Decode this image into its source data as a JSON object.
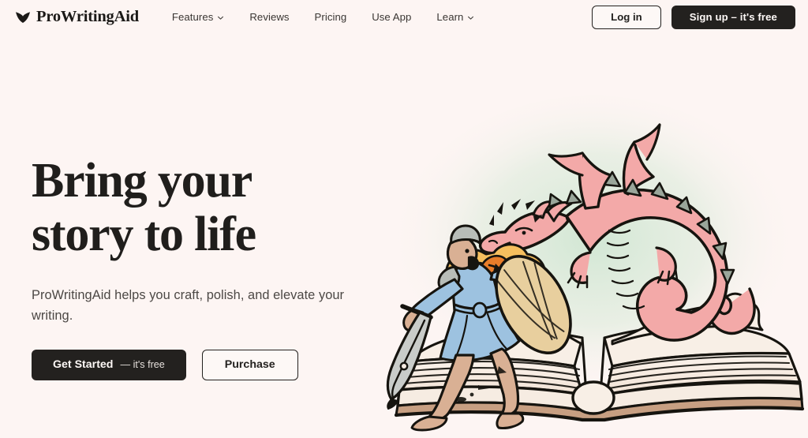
{
  "header": {
    "brand": {
      "name": "ProWritingAid",
      "mark_icon": "feather-chevron-logo-icon"
    },
    "nav": [
      {
        "label": "Features",
        "has_dropdown": true,
        "icon": "chevron-down-icon"
      },
      {
        "label": "Reviews",
        "has_dropdown": false,
        "icon": ""
      },
      {
        "label": "Pricing",
        "has_dropdown": false,
        "icon": ""
      },
      {
        "label": "Use App",
        "has_dropdown": false,
        "icon": ""
      },
      {
        "label": "Learn",
        "has_dropdown": true,
        "icon": "chevron-down-icon"
      }
    ],
    "login_label": "Log in",
    "signup_label": "Sign up – it's free"
  },
  "hero": {
    "title_line1": "Bring your",
    "title_line2": "story to life",
    "subtitle": "ProWritingAid helps you craft, polish, and elevate your writing.",
    "cta_primary_strong": "Get Started",
    "cta_primary_light": "— it's free",
    "cta_secondary": "Purchase",
    "illustration_name": "knight-fighting-dragon-on-open-book-illustration"
  },
  "colors": {
    "page_background": "#fdf5f3",
    "ink": "#23211f",
    "body_text": "#4c4845",
    "dragon_pink": "#f3a9a8",
    "dragon_spine_grey": "#9aa69a",
    "knight_robe_blue": "#9dc2e0",
    "knight_skin": "#d9b094",
    "shield_tan": "#e8cf9e",
    "fire_orange": "#e87d2a",
    "fire_yellow": "#f6bf5e",
    "book_page": "#f6ece4",
    "book_edge_tan": "#c79f82",
    "wash_green": "#cfe3cf"
  }
}
